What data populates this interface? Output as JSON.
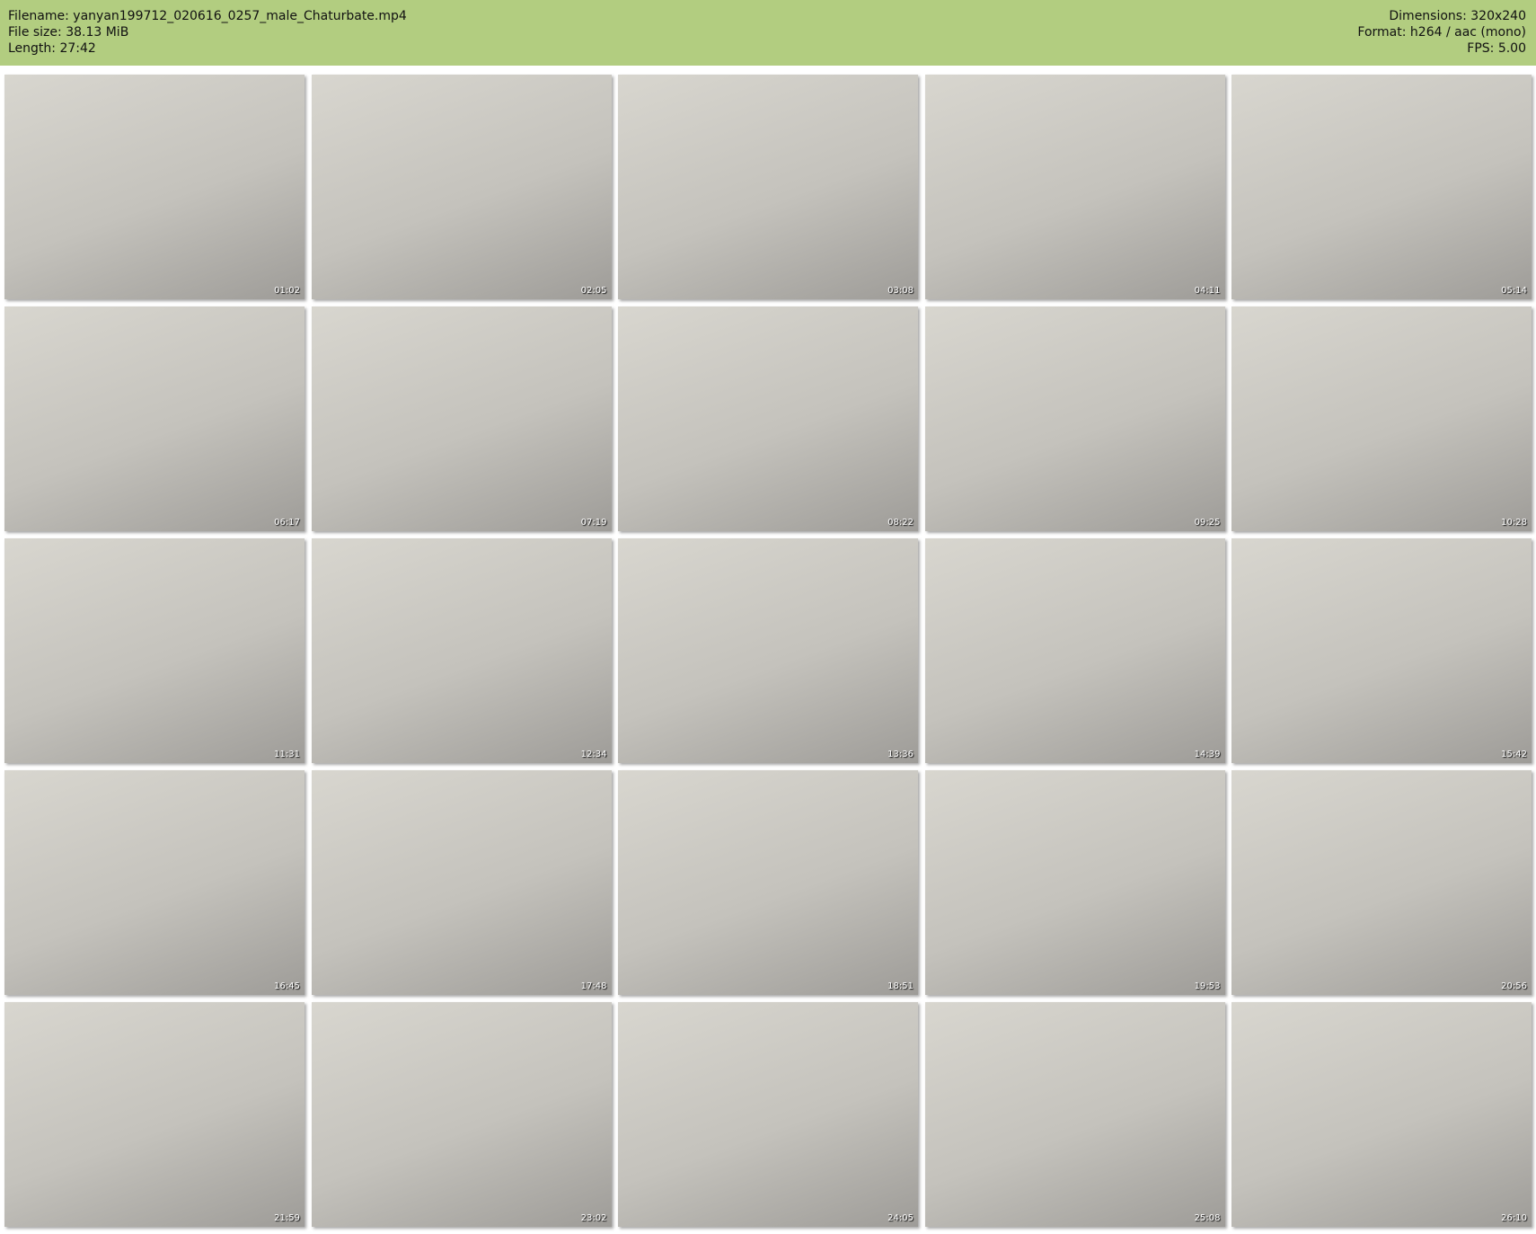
{
  "header": {
    "filename": "Filename: yanyan199712_020616_0257_male_Chaturbate.mp4",
    "filesize": "File size: 38.13 MiB",
    "length": "Length: 27:42",
    "dimensions": "Dimensions: 320x240",
    "format": "Format: h264 / aac (mono)",
    "fps": "FPS: 5.00"
  },
  "accent_color": "#b2cd80",
  "thumbnails": [
    "01:02",
    "02:05",
    "03:08",
    "04:11",
    "05:14",
    "06:17",
    "07:19",
    "08:22",
    "09:25",
    "10:28",
    "11:31",
    "12:34",
    "13:36",
    "14:39",
    "15:42",
    "16:45",
    "17:48",
    "18:51",
    "19:53",
    "20:56",
    "21:59",
    "23:02",
    "24:05",
    "25:08",
    "26:10"
  ]
}
